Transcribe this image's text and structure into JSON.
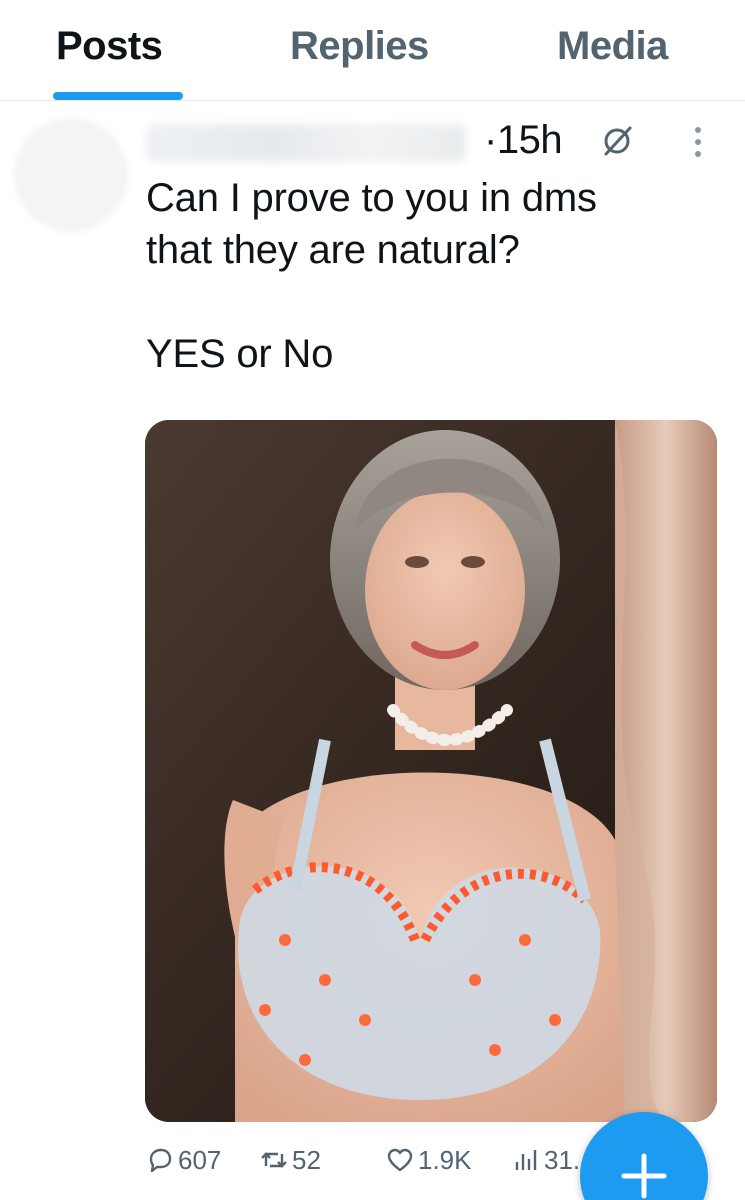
{
  "tabs": [
    {
      "label": "Posts",
      "active": true
    },
    {
      "label": "Replies",
      "active": false
    },
    {
      "label": "Media",
      "active": false
    }
  ],
  "post": {
    "timestamp": "·15h",
    "text": "Can I prove to you in dms\nthat they are natural?\n\nYES or No",
    "media": {
      "kind": "photo"
    },
    "actions": {
      "replies": "607",
      "reposts": "52",
      "likes": "1.9K",
      "views": "31."
    }
  },
  "icons": {
    "reply": "reply-icon",
    "repost": "repost-icon",
    "like": "like-icon",
    "views": "views-icon",
    "grok": "grok-icon",
    "more": "more-dots-icon",
    "compose": "plus-icon"
  },
  "colors": {
    "accent": "#1d9bf0",
    "text_primary": "#0f1419",
    "text_secondary": "#536471",
    "divider": "#e6e9ec"
  }
}
